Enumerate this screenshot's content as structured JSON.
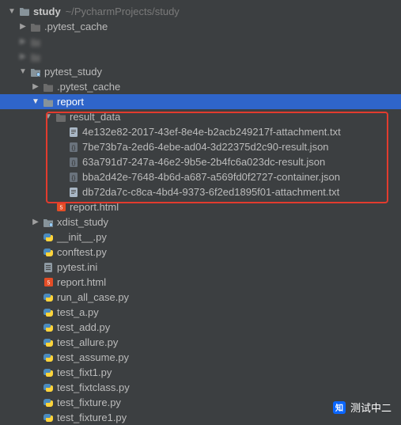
{
  "project": {
    "name": "study",
    "path": "~/PycharmProjects/study"
  },
  "tree": [
    {
      "indent": 8,
      "arrow": "down",
      "icon": "project-root",
      "label_path": "project.name",
      "extra_path": "project.path",
      "interact": true,
      "bold": true
    },
    {
      "indent": 22,
      "arrow": "right",
      "icon": "folder-dim",
      "label_path": "labels.pytest_cache",
      "interact": true
    },
    {
      "indent": 22,
      "arrow": "right",
      "icon": "folder-dim",
      "label_path": "labels.blank1",
      "interact": true,
      "dim": true
    },
    {
      "indent": 22,
      "arrow": "right",
      "icon": "folder-dim",
      "label_path": "labels.blank2",
      "interact": true,
      "dim": true
    },
    {
      "indent": 22,
      "arrow": "down",
      "icon": "pkg",
      "label_path": "labels.pytest_study",
      "interact": true
    },
    {
      "indent": 38,
      "arrow": "right",
      "icon": "folder-dim",
      "label_path": "labels.pytest_cache",
      "interact": true
    },
    {
      "indent": 38,
      "arrow": "down",
      "icon": "folder",
      "label_path": "labels.report",
      "interact": true,
      "selected": true
    },
    {
      "indent": 54,
      "arrow": "down",
      "icon": "folder-dim",
      "label_path": "labels.result_data",
      "interact": true
    },
    {
      "indent": 70,
      "arrow": "none",
      "icon": "txt",
      "label_path": "files.0",
      "interact": true
    },
    {
      "indent": 70,
      "arrow": "none",
      "icon": "json",
      "label_path": "files.1",
      "interact": true
    },
    {
      "indent": 70,
      "arrow": "none",
      "icon": "json",
      "label_path": "files.2",
      "interact": true
    },
    {
      "indent": 70,
      "arrow": "none",
      "icon": "json",
      "label_path": "files.3",
      "interact": true
    },
    {
      "indent": 70,
      "arrow": "none",
      "icon": "txt",
      "label_path": "files.4",
      "interact": true
    },
    {
      "indent": 54,
      "arrow": "none",
      "icon": "html",
      "label_path": "labels.report_html",
      "interact": true
    },
    {
      "indent": 38,
      "arrow": "right",
      "icon": "pkg",
      "label_path": "labels.xdist_study",
      "interact": true
    },
    {
      "indent": 38,
      "arrow": "none",
      "icon": "py",
      "label_path": "labels.init",
      "interact": true
    },
    {
      "indent": 38,
      "arrow": "none",
      "icon": "py",
      "label_path": "labels.conftest",
      "interact": true
    },
    {
      "indent": 38,
      "arrow": "none",
      "icon": "ini",
      "label_path": "labels.pytest_ini",
      "interact": true
    },
    {
      "indent": 38,
      "arrow": "none",
      "icon": "html",
      "label_path": "labels.report_html",
      "interact": true
    },
    {
      "indent": 38,
      "arrow": "none",
      "icon": "py",
      "label_path": "labels.run_all",
      "interact": true
    },
    {
      "indent": 38,
      "arrow": "none",
      "icon": "py",
      "label_path": "labels.test_a",
      "interact": true
    },
    {
      "indent": 38,
      "arrow": "none",
      "icon": "py",
      "label_path": "labels.test_add",
      "interact": true
    },
    {
      "indent": 38,
      "arrow": "none",
      "icon": "py",
      "label_path": "labels.test_allure",
      "interact": true
    },
    {
      "indent": 38,
      "arrow": "none",
      "icon": "py",
      "label_path": "labels.test_assume",
      "interact": true
    },
    {
      "indent": 38,
      "arrow": "none",
      "icon": "py",
      "label_path": "labels.test_fixt1",
      "interact": true
    },
    {
      "indent": 38,
      "arrow": "none",
      "icon": "py",
      "label_path": "labels.test_fixtclass",
      "interact": true
    },
    {
      "indent": 38,
      "arrow": "none",
      "icon": "py",
      "label_path": "labels.test_fixture",
      "interact": true
    },
    {
      "indent": 38,
      "arrow": "none",
      "icon": "py",
      "label_path": "labels.test_fixture1",
      "interact": true
    }
  ],
  "labels": {
    "pytest_cache": ".pytest_cache",
    "blank1": "      ",
    "blank2": "      ",
    "pytest_study": "pytest_study",
    "report": "report",
    "result_data": "result_data",
    "report_html": "report.html",
    "xdist_study": "xdist_study",
    "init": "__init__.py",
    "conftest": "conftest.py",
    "pytest_ini": "pytest.ini",
    "run_all": "run_all_case.py",
    "test_a": "test_a.py",
    "test_add": "test_add.py",
    "test_allure": "test_allure.py",
    "test_assume": "test_assume.py",
    "test_fixt1": "test_fixt1.py",
    "test_fixtclass": "test_fixtclass.py",
    "test_fixture": "test_fixture.py",
    "test_fixture1": "test_fixture1.py"
  },
  "files": [
    "4e132e82-2017-43ef-8e4e-b2acb249217f-attachment.txt",
    "7be73b7a-2ed6-4ebe-ad04-3d22375d2c90-result.json",
    "63a791d7-247a-46e2-9b5e-2b4fc6a023dc-result.json",
    "bba2d42e-7648-4b6d-a687-a569fd0f2727-container.json",
    "db72da7c-c8ca-4bd4-9373-6f2ed1895f01-attachment.txt"
  ],
  "icons_semantic": {
    "project-root": "folder",
    "folder": "folder",
    "folder-dim": "folder (excluded)",
    "pkg": "python package",
    "py": "python file",
    "json": "json file",
    "txt": "text file",
    "html": "html file",
    "ini": "config file"
  },
  "watermark": "测试中二"
}
